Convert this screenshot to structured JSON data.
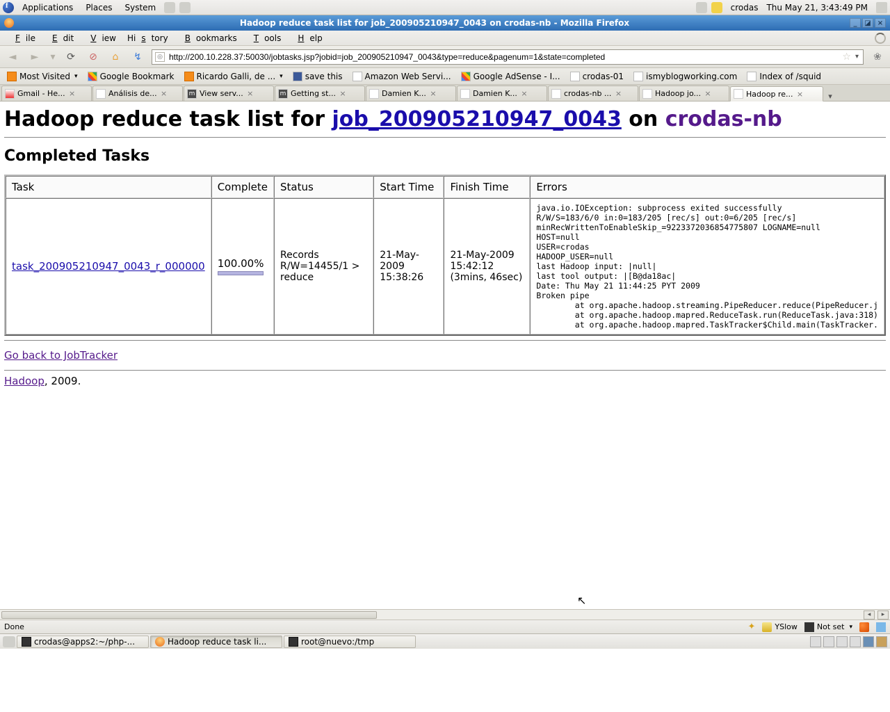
{
  "gnome": {
    "menus": [
      "Applications",
      "Places",
      "System"
    ],
    "user": "crodas",
    "clock": "Thu May 21,  3:43:49 PM"
  },
  "window_title": "Hadoop reduce task list for job_200905210947_0043 on crodas-nb - Mozilla Firefox",
  "menubar": [
    {
      "u": "F",
      "r": "ile"
    },
    {
      "u": "E",
      "r": "dit"
    },
    {
      "u": "V",
      "r": "iew"
    },
    {
      "u": "Hi",
      "r": "story",
      "pre": "Hi",
      "mid": "s",
      "post": "tory"
    },
    {
      "u": "B",
      "r": "ookmarks"
    },
    {
      "u": "T",
      "r": "ools"
    },
    {
      "u": "H",
      "r": "elp"
    }
  ],
  "url": "http://200.10.228.37:50030/jobtasks.jsp?jobid=job_200905210947_0043&type=reduce&pagenum=1&state=completed",
  "bookmarks": [
    {
      "t": "Most Visited",
      "ico": "rss",
      "dd": true
    },
    {
      "t": "Google Bookmark",
      "ico": "g"
    },
    {
      "t": "Ricardo Galli, de ...",
      "ico": "rss",
      "dd": true
    },
    {
      "t": "save this",
      "ico": "del"
    },
    {
      "t": "Amazon Web Servi...",
      "ico": ""
    },
    {
      "t": "Google AdSense - I...",
      "ico": "g"
    },
    {
      "t": "crodas-01",
      "ico": ""
    },
    {
      "t": "ismyblogworking.com",
      "ico": ""
    },
    {
      "t": "Index of /squid",
      "ico": ""
    }
  ],
  "tabs": [
    {
      "t": "Gmail - He...",
      "ico": "gm"
    },
    {
      "t": "Análisis de...",
      "ico": ""
    },
    {
      "t": "View serv...",
      "ico": "m"
    },
    {
      "t": "Getting st...",
      "ico": "m"
    },
    {
      "t": "Damien K...",
      "ico": ""
    },
    {
      "t": "Damien K...",
      "ico": ""
    },
    {
      "t": "crodas-nb ...",
      "ico": ""
    },
    {
      "t": "Hadoop jo...",
      "ico": ""
    },
    {
      "t": "Hadoop re...",
      "ico": "",
      "active": true
    }
  ],
  "page": {
    "h1_pre": "Hadoop reduce task list for ",
    "h1_job": "job_200905210947_0043",
    "h1_mid": " on ",
    "h1_host": "crodas-nb",
    "h2": "Completed Tasks",
    "cols": [
      "Task",
      "Complete",
      "Status",
      "Start Time",
      "Finish Time",
      "Errors"
    ],
    "row": {
      "task": "task_200905210947_0043_r_000000",
      "pct": "100.00%",
      "pct_fill": 100,
      "status": "Records R/W=14455/1 > reduce",
      "start": "21-May-2009 15:38:26",
      "finish": "21-May-2009 15:42:12 (3mins, 46sec)",
      "errors": "java.io.IOException: subprocess exited successfully\nR/W/S=183/6/0 in:0=183/205 [rec/s] out:0=6/205 [rec/s]\nminRecWrittenToEnableSkip_=9223372036854775807 LOGNAME=null\nHOST=null\nUSER=crodas\nHADOOP_USER=null\nlast Hadoop input: |null|\nlast tool output: |[B@da18ac|\nDate: Thu May 21 11:44:25 PYT 2009\nBroken pipe\n        at org.apache.hadoop.streaming.PipeReducer.reduce(PipeReducer.j\n        at org.apache.hadoop.mapred.ReduceTask.run(ReduceTask.java:318)\n        at org.apache.hadoop.mapred.TaskTracker$Child.main(TaskTracker."
    },
    "back": "Go back to JobTracker",
    "hadoop": "Hadoop",
    "year": ", 2009."
  },
  "status": {
    "done": "Done",
    "yslow": "YSlow",
    "noscript": "Not set"
  },
  "taskbar": [
    {
      "t": "crodas@apps2:~/php-...",
      "ico": "term"
    },
    {
      "t": "Hadoop reduce task li...",
      "ico": "ff",
      "active": true
    },
    {
      "t": "root@nuevo:/tmp",
      "ico": "term"
    }
  ]
}
